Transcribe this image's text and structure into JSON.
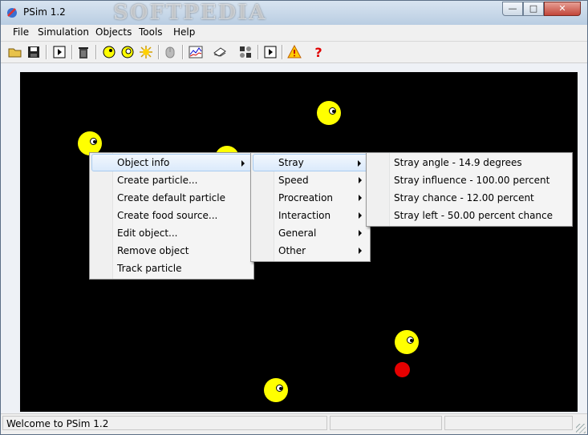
{
  "window": {
    "title": "PSim 1.2",
    "watermark": "SOFTPEDIA"
  },
  "menubar": {
    "items": [
      "File",
      "Simulation",
      "Objects",
      "Tools",
      "Help"
    ]
  },
  "toolbar": {
    "icons": [
      "open-folder-icon",
      "save-disk-icon",
      "run-simulation-icon",
      "trash-icon",
      "add-particle-icon",
      "add-default-particle-icon",
      "add-food-source-icon",
      "mouse-icon",
      "graph-icon",
      "book-icon",
      "settings-icon",
      "play-icon",
      "warning-icon",
      "help-icon"
    ]
  },
  "context_menu": {
    "items": [
      "Object info",
      "Create particle...",
      "Create default particle",
      "Create food source...",
      "Edit object...",
      "Remove object",
      "Track particle"
    ],
    "highlighted": "Object info"
  },
  "submenu_object_info": {
    "items": [
      "Stray",
      "Speed",
      "Procreation",
      "Interaction",
      "General",
      "Other"
    ],
    "highlighted": "Stray"
  },
  "submenu_stray": {
    "items": [
      "Stray angle - 14.9 degrees",
      "Stray influence - 100.00 percent",
      "Stray chance - 12.00 percent",
      "Stray left - 50.00 percent chance"
    ]
  },
  "statusbar": {
    "text": "Welcome to PSim 1.2"
  },
  "colors": {
    "particle": "#ffff00",
    "food": "#e60000",
    "canvas": "#000000",
    "highlight": "#dbeafb"
  }
}
